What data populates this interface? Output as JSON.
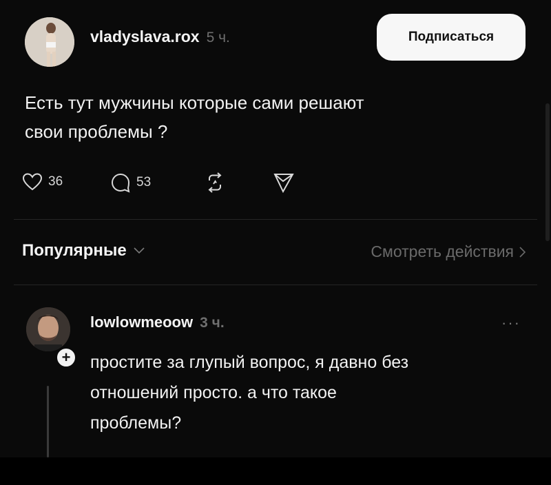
{
  "post": {
    "username": "vladyslava.rox",
    "timestamp": "5 ч.",
    "follow_label": "Подписаться",
    "text_line1": "Есть тут мужчины которые сами решают",
    "text_line2": "свои проблемы ?",
    "likes": "36",
    "comments": "53"
  },
  "replies_header": {
    "sort_label": "Популярные",
    "activity_label": "Смотреть действия"
  },
  "comment": {
    "username": "lowlowmeoow",
    "timestamp": "3 ч.",
    "more": "···",
    "plus": "+",
    "line1": "простите за глупый вопрос, я давно без",
    "line2": "отношений просто. а что такое",
    "line3": "проблемы?"
  },
  "icons": {
    "like": "heart-icon",
    "comment": "speech-bubble-icon",
    "repost": "repost-icon",
    "share": "send-icon",
    "sort": "chevron-down-icon",
    "activity": "chevron-right-icon"
  }
}
